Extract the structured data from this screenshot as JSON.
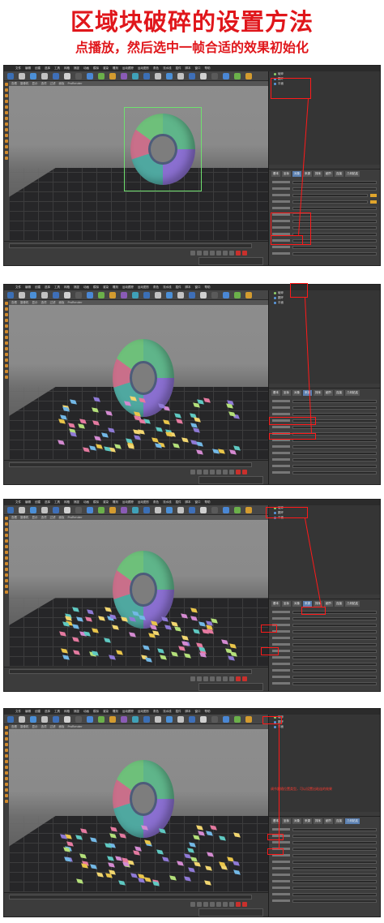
{
  "title": "区域块破碎的设置方法",
  "subtitle": "点播放，然后选中一帧合适的效果初始化",
  "app": {
    "menu": [
      "文件",
      "编辑",
      "创建",
      "选择",
      "工具",
      "网格",
      "捕捉",
      "动画",
      "模拟",
      "渲染",
      "雕刻",
      "运动跟踪",
      "运动图形",
      "角色",
      "流水线",
      "插件",
      "脚本",
      "窗口",
      "帮助"
    ],
    "viewport_menu": [
      "查看",
      "摄像机",
      "显示",
      "选项",
      "过滤",
      "面板",
      "ProRender"
    ],
    "object_tree": [
      "破碎",
      "圆环",
      "平面"
    ],
    "attr_tabs": [
      "基本",
      "坐标",
      "对象",
      "来源",
      "排序",
      "细节",
      "连接",
      "几何粘连"
    ],
    "note_text": "调节跟随位置类型，可以设置出粘连的效果"
  },
  "colors": {
    "accent": "#e0161b",
    "highlight": "#ff1a1a",
    "tab_active": "#5a7fb0"
  }
}
